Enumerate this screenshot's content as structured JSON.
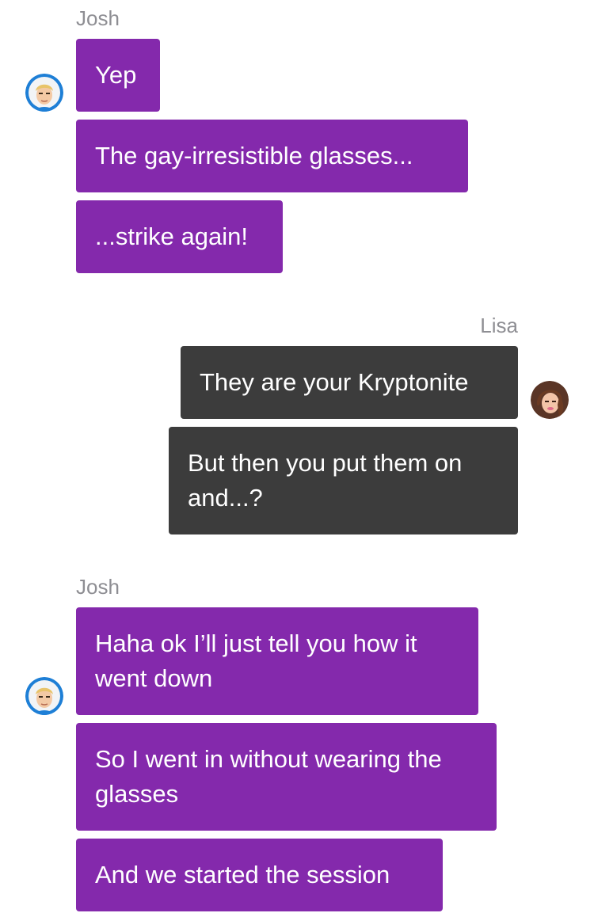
{
  "messages": [
    {
      "sender": "Josh",
      "texts": [
        "Yep",
        "The gay-irresistible glasses...",
        "...strike again!"
      ]
    },
    {
      "sender": "Lisa",
      "texts": [
        "They are your Kryptonite",
        "But then you put them on and...?"
      ]
    },
    {
      "sender": "Josh",
      "texts": [
        "Haha ok I’ll just tell you how it went down",
        "So I went in without wearing the glasses",
        "And we started the session"
      ]
    }
  ],
  "colors": {
    "josh_bubble": "#8429ac",
    "lisa_bubble": "#3c3c3c",
    "name_text": "#8e8e93"
  },
  "icons": [
    "josh-avatar",
    "lisa-avatar"
  ]
}
